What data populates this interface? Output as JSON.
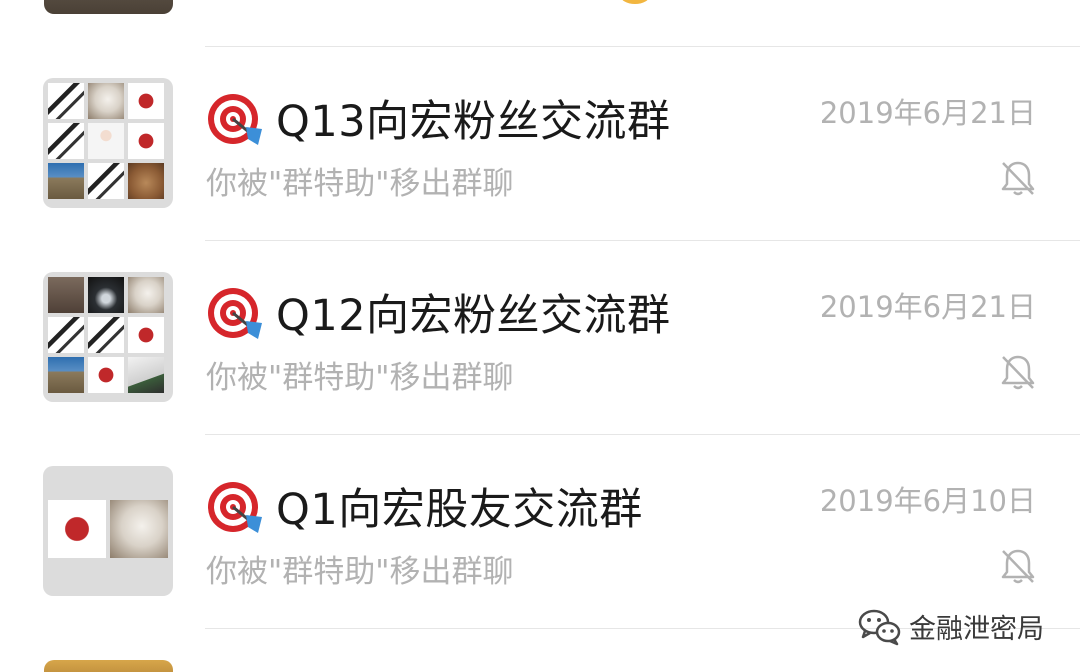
{
  "chats": [
    {
      "title": "Q13向宏粉丝交流群",
      "date": "2019年6月21日",
      "preview": "你被\"群特助\"移出群聊",
      "title_icon": "target-dart-icon",
      "status_icon": "mute-bell-icon"
    },
    {
      "title": "Q12向宏粉丝交流群",
      "date": "2019年6月21日",
      "preview": "你被\"群特助\"移出群聊",
      "title_icon": "target-dart-icon",
      "status_icon": "mute-bell-icon"
    },
    {
      "title": "Q1向宏股友交流群",
      "date": "2019年6月10日",
      "preview": "你被\"群特助\"移出群聊",
      "title_icon": "target-dart-icon",
      "status_icon": "mute-bell-icon"
    }
  ],
  "watermark": {
    "text": "金融泄密局",
    "icon": "wechat-logo-icon"
  },
  "colors": {
    "title": "#1a1a1a",
    "secondary_text": "#b2b2b2",
    "divider": "#e6e6e6",
    "avatar_bg": "#dcdcdc",
    "target_red": "#d6262b",
    "dart_blue": "#3c8fd8"
  }
}
